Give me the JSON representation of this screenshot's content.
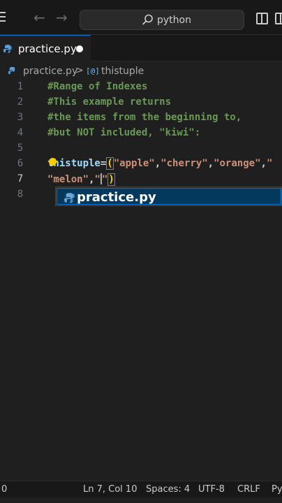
{
  "titlebar": {
    "search_text": "python"
  },
  "tab": {
    "label": "practice.py"
  },
  "breadcrumb": {
    "file": "practice.py",
    "separator": ">",
    "symbol_icon_glyph": "[@]",
    "symbol": "thistuple"
  },
  "editor": {
    "lines": [
      {
        "number": "1",
        "text": "#Range of Indexes"
      },
      {
        "number": "2",
        "text": "#This example returns"
      },
      {
        "number": "3",
        "text": "#the items from the beginning to,"
      },
      {
        "number": "4",
        "text": "#but NOT included, \"kiwi\":"
      },
      {
        "number": "5",
        "text": ""
      },
      {
        "number": "6",
        "text": "thistuple=(\"apple\",\"cherry\",\"orange\",\""
      },
      {
        "number": "7",
        "text": "\"melon\",\"\")"
      },
      {
        "number": "8",
        "text": ""
      }
    ],
    "line6": {
      "var": "thistuple",
      "op": "=",
      "paren": "(",
      "s1": "\"apple\"",
      "c1": ",",
      "s2": "\"cherry\"",
      "c2": ",",
      "s3": "\"orange\"",
      "c3": ",",
      "s4": "\""
    },
    "line7": {
      "s1": "\"melon\"",
      "c1": ",",
      "s2a": "\"",
      "s2b": "\"",
      "paren": ")"
    }
  },
  "suggestion": {
    "label": "practice.py"
  },
  "statusbar": {
    "left": "0",
    "position": "Ln 7, Col 10",
    "spaces": "Spaces: 4",
    "encoding": "UTF-8",
    "eol": "CRLF",
    "language": "Py"
  },
  "colors": {
    "accent": "#0078d4",
    "comment": "#6a9955",
    "string": "#ce9178",
    "variable": "#9cdcfe",
    "bracket": "#ffd700"
  }
}
